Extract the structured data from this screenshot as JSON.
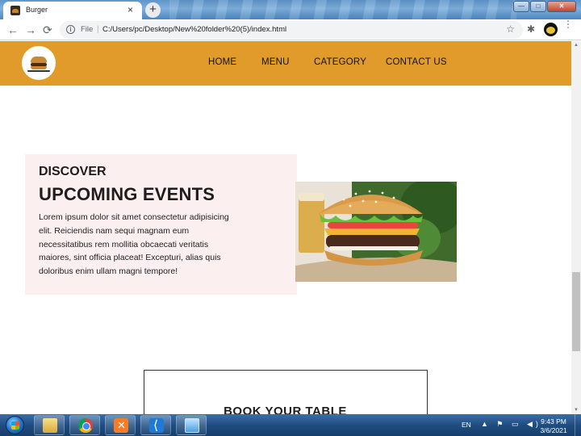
{
  "browser": {
    "tab_title": "Burger",
    "tab_close": "×",
    "new_tab": "+",
    "file_label": "File",
    "separator": "|",
    "url": "C:/Users/pc/Desktop/New%20folder%20(5)/index.html",
    "back": "←",
    "forward": "→",
    "reload": "⟳",
    "star": "☆",
    "extensions": "✱",
    "menu": "⋮",
    "window_min": "—",
    "window_max": "□",
    "window_close": "✕"
  },
  "site": {
    "nav": [
      "HOME",
      "MENU",
      "CATEGORY",
      "CONTACT US"
    ],
    "events": {
      "kicker": "DISCOVER",
      "heading": "UPCOMING EVENTS",
      "body": "Lorem ipsum dolor sit amet consectetur adipisicing elit. Reiciendis nam sequi magnam eum necessitatibus rem mollitia obcaecati veritatis maiores, sint officia placeat! Excepturi, alias quis doloribus enim ullam magni tempore!"
    },
    "booking": {
      "heading": "BOOK YOUR TABLE"
    }
  },
  "taskbar": {
    "language": "EN",
    "tray": "▲ ⚑ ▭ ◀)",
    "time": "9:43 PM",
    "date": "3/6/2021"
  },
  "colors": {
    "header": "#e09b2a",
    "events_card": "#fbeff0",
    "taskbar": "#1f4d82"
  },
  "icons": [
    "burger-favicon",
    "info-icon",
    "star-icon",
    "puzzle-extensions-icon",
    "profile-avatar",
    "logo-burger-icon",
    "start-orb",
    "folder-icon",
    "chrome-icon",
    "xampp-icon",
    "vscode-icon",
    "window-icon"
  ]
}
